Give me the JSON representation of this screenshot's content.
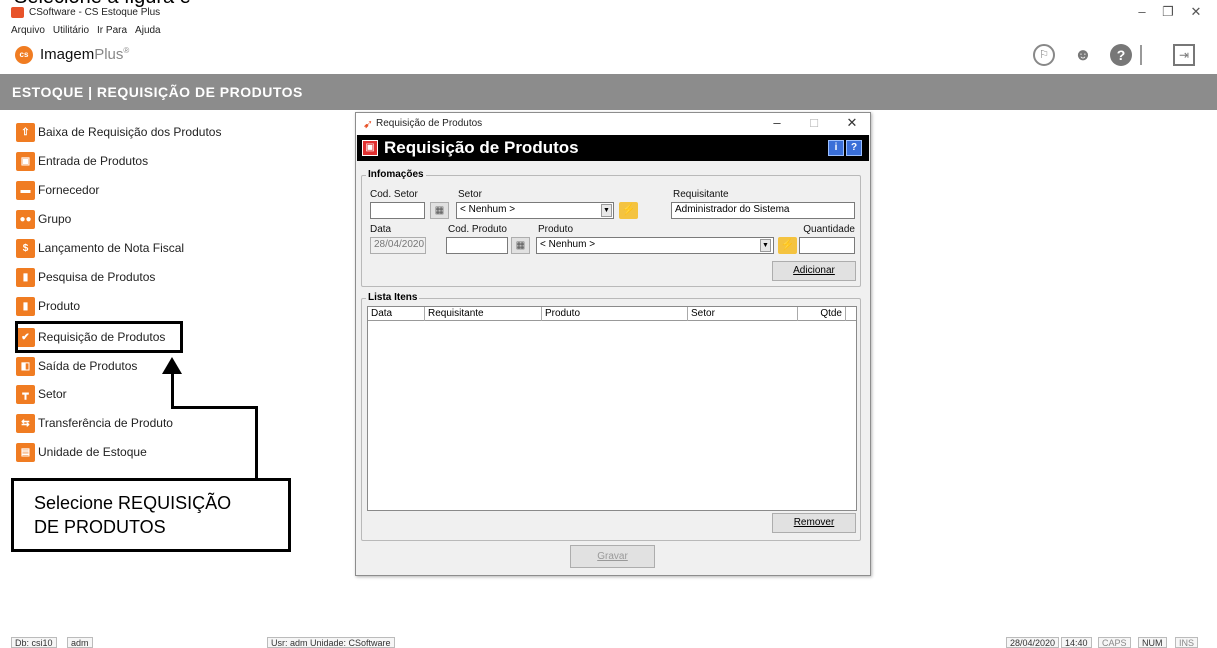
{
  "caption_top": "Selecione a figura e",
  "window": {
    "title": "CSoftware - CS Estoque Plus"
  },
  "menu": [
    "Arquivo",
    "Utilitário",
    "Ir Para",
    "Ajuda"
  ],
  "brand": {
    "name": "Imagem",
    "suffix": "Plus",
    "mark": "®",
    "logo_text": "cs"
  },
  "header": {
    "title": "ESTOQUE | REQUISIÇÃO DE PRODUTOS"
  },
  "sidebar": {
    "items": [
      {
        "label": "Baixa de Requisição dos Produtos",
        "icon": "box-up-icon"
      },
      {
        "label": "Entrada de Produtos",
        "icon": "box-open-icon"
      },
      {
        "label": "Fornecedor",
        "icon": "truck-icon"
      },
      {
        "label": "Grupo",
        "icon": "users-icon"
      },
      {
        "label": "Lançamento de Nota Fiscal",
        "icon": "money-icon"
      },
      {
        "label": "Pesquisa de Produtos",
        "icon": "cylinder-icon"
      },
      {
        "label": "Produto",
        "icon": "cylinder-icon"
      },
      {
        "label": "Requisição de Produtos",
        "icon": "check-icon"
      },
      {
        "label": "Saída de Produtos",
        "icon": "exit-box-icon"
      },
      {
        "label": "Setor",
        "icon": "hierarchy-icon"
      },
      {
        "label": "Transferência de Produto",
        "icon": "transfer-icon"
      },
      {
        "label": "Unidade de Estoque",
        "icon": "unit-icon"
      }
    ]
  },
  "callout": {
    "line1": "Selecione REQUISIÇÃO",
    "line2": "DE PRODUTOS"
  },
  "dialog": {
    "title": "Requisição de Produtos",
    "banner_title": "Requisição de Produtos",
    "info_group": "Infomações",
    "fields": {
      "cod_setor_label": "Cod. Setor",
      "cod_setor_value": "",
      "setor_label": "Setor",
      "setor_value": "< Nenhum >",
      "requisitante_label": "Requisitante",
      "requisitante_value": "Administrador do Sistema",
      "data_label": "Data",
      "data_value": "28/04/2020",
      "cod_produto_label": "Cod. Produto",
      "cod_produto_value": "",
      "produto_label": "Produto",
      "produto_value": "< Nenhum >",
      "quantidade_label": "Quantidade",
      "quantidade_value": ""
    },
    "add_button": "Adicionar",
    "list_group": "Lista Itens",
    "columns": [
      "Data",
      "Requisitante",
      "Produto",
      "Setor",
      "Qtde"
    ],
    "rows": [],
    "remove_button": "Remover",
    "save_button": "Gravar"
  },
  "statusbar": {
    "db": "Db: csi10",
    "user_short": "adm",
    "user_unit": "Usr: adm  Unidade: CSoftware",
    "date": "28/04/2020",
    "time": "14:40",
    "caps": "CAPS",
    "num": "NUM",
    "ins": "INS"
  }
}
